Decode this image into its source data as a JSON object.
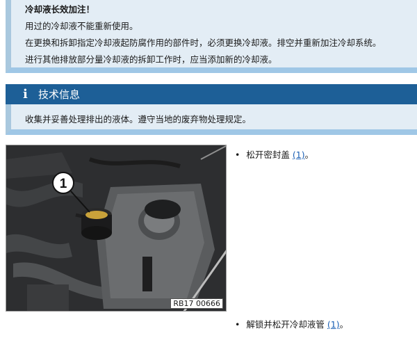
{
  "warning": {
    "title": "冷却液长效加注！",
    "lines": [
      "用过的冷却液不能重新使用。",
      "在更换和拆卸指定冷却液起防腐作用的部件时，必须更换冷却液。排空并重新加注冷却系统。",
      "进行其他排放部分量冷却液的拆卸工作时，应当添加新的冷却液。"
    ]
  },
  "info": {
    "icon": "info-icon",
    "title": "技术信息",
    "text": "收集并妥善处理排出的液体。遵守当地的废弃物处理规定。"
  },
  "figure": {
    "callout": "1",
    "code": "RB17 00666"
  },
  "steps": [
    {
      "bullet": "•",
      "text": "松开密封盖",
      "ref": "(1)",
      "end": "。"
    },
    {
      "bullet": "•",
      "text": "解锁并松开冷却液管",
      "ref": "(1)",
      "end": "。"
    }
  ],
  "colors": {
    "info_header": "#1d5f97",
    "box_background": "#e3edf5",
    "box_border": "#9fc7e6",
    "link": "#1a5fb4"
  }
}
